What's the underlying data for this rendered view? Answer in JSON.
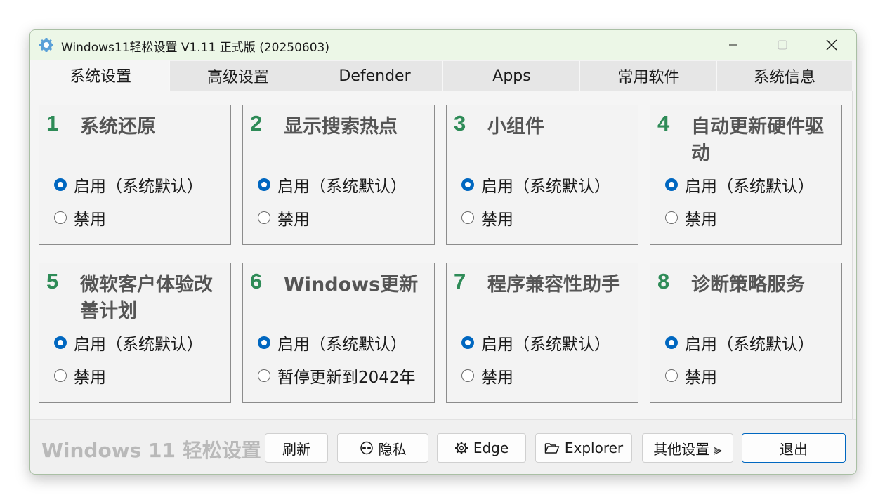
{
  "window": {
    "title": "Windows11轻松设置 V1.11 正式版 (20250603)"
  },
  "tabs": [
    {
      "label": "系统设置",
      "active": true
    },
    {
      "label": "高级设置",
      "active": false
    },
    {
      "label": "Defender",
      "active": false
    },
    {
      "label": "Apps",
      "active": false
    },
    {
      "label": "常用软件",
      "active": false
    },
    {
      "label": "系统信息",
      "active": false
    }
  ],
  "panels": [
    {
      "num": "1",
      "title": "系统还原",
      "opt1": "启用（系统默认）",
      "opt2": "禁用",
      "selected": 1
    },
    {
      "num": "2",
      "title": "显示搜索热点",
      "opt1": "启用（系统默认）",
      "opt2": "禁用",
      "selected": 1
    },
    {
      "num": "3",
      "title": "小组件",
      "opt1": "启用（系统默认）",
      "opt2": "禁用",
      "selected": 1
    },
    {
      "num": "4",
      "title": "自动更新硬件驱动",
      "opt1": "启用（系统默认）",
      "opt2": "禁用",
      "selected": 1
    },
    {
      "num": "5",
      "title": "微软客户体验改善计划",
      "opt1": "启用（系统默认）",
      "opt2": "禁用",
      "selected": 1
    },
    {
      "num": "6",
      "title": "Windows更新",
      "opt1": "启用（系统默认）",
      "opt2": "暂停更新到2042年",
      "selected": 1
    },
    {
      "num": "7",
      "title": "程序兼容性助手",
      "opt1": "启用（系统默认）",
      "opt2": "禁用",
      "selected": 1
    },
    {
      "num": "8",
      "title": "诊断策略服务",
      "opt1": "启用（系统默认）",
      "opt2": "禁用",
      "selected": 1
    }
  ],
  "footer": {
    "brand": "Windows 11 轻松设置",
    "refresh": "刷新",
    "privacy": "隐私",
    "edge": "Edge",
    "explorer": "Explorer",
    "other": "其他设置 ⫸",
    "exit": "退出"
  },
  "colors": {
    "accent": "#0067c0",
    "number": "#2e8b57",
    "titlebar": "#ecf7e7"
  },
  "icons": {
    "app": "gear-app-icon",
    "privacy": "alien-icon",
    "edge": "gear-icon",
    "explorer": "folder-icon"
  }
}
